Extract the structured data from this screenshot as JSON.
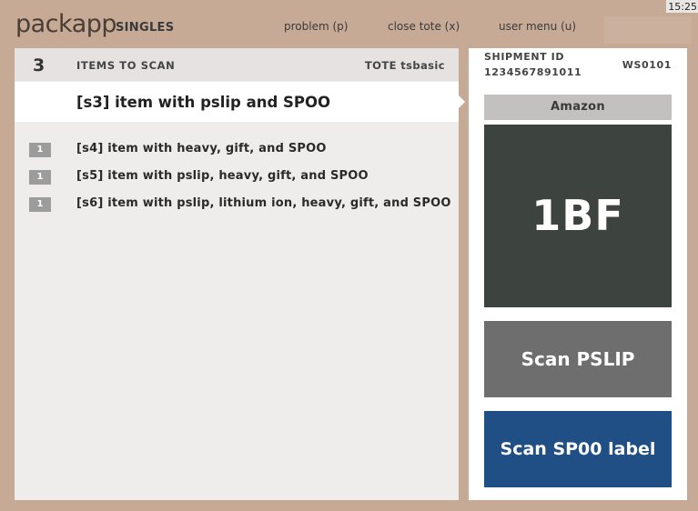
{
  "clock": "15:25",
  "header": {
    "logo_light": "pack",
    "logo_bold": "app",
    "mode": "SINGLES",
    "nav": [
      {
        "label": "problem (p)"
      },
      {
        "label": "close tote (x)"
      },
      {
        "label": "user menu (u)"
      }
    ]
  },
  "scan_list": {
    "count": "3",
    "title": "ITEMS TO SCAN",
    "tote": "TOTE tsbasic",
    "current_item": "[s3] item with pslip and SPOO",
    "items": [
      {
        "qty": "1",
        "label": "[s4] item with heavy, gift, and SPOO"
      },
      {
        "qty": "1",
        "label": "[s5] item with pslip, heavy, gift, and SPOO"
      },
      {
        "qty": "1",
        "label": "[s6] item with pslip, lithium ion, heavy, gift, and SPOO"
      }
    ]
  },
  "shipment": {
    "id_label": "SHIPMENT ID",
    "id": "1234567891011",
    "station": "WS0101",
    "carrier": "Amazon",
    "box_code": "1BF",
    "scan_pslip_label": "Scan PSLIP",
    "scan_spoo_label": "Scan SP00 label"
  },
  "colors": {
    "background": "#c6aa96",
    "box_tile": "#3d433f",
    "pslip_button": "#6e6e6e",
    "spoo_button": "#1f4f84"
  }
}
